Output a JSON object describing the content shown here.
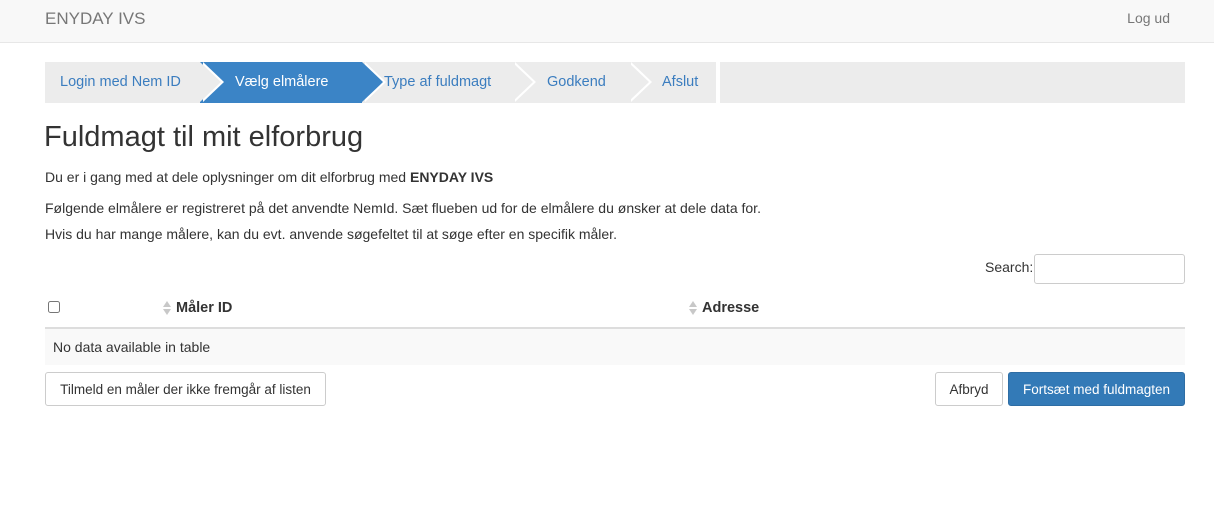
{
  "navbar": {
    "brand": "ENYDAY IVS",
    "logout": "Log ud"
  },
  "wizard": {
    "steps": [
      {
        "label": "Login med Nem ID",
        "active": false
      },
      {
        "label": "Vælg elmålere",
        "active": true
      },
      {
        "label": "Type af fuldmagt",
        "active": false
      },
      {
        "label": "Godkend",
        "active": false
      },
      {
        "label": "Afslut",
        "active": false
      }
    ]
  },
  "page": {
    "title": "Fuldmagt til mit elforbrug",
    "intro_text": "Du er i gang med at dele oplysninger om dit elforbrug med ",
    "intro_company": "ENYDAY IVS",
    "info_line1": "Følgende elmålere er registreret på det anvendte NemId. Sæt flueben ud for de elmålere du ønsker at dele data for.",
    "info_line2": "Hvis du har mange målere, kan du evt. anvende søgefeltet til at søge efter en specifik måler."
  },
  "search": {
    "label": "Search:",
    "value": ""
  },
  "table": {
    "columns": [
      "Måler ID",
      "Adresse"
    ],
    "select_all_checked": false,
    "empty_message": "No data available in table"
  },
  "buttons": {
    "register": "Tilmeld en måler der ikke fremgår af listen",
    "cancel": "Afbryd",
    "continue": "Fortsæt med fuldmagten"
  },
  "colors": {
    "primary": "#337ab7",
    "active_step": "#3b84c6",
    "step_bg": "#ececec",
    "link": "#3b7dbf"
  }
}
